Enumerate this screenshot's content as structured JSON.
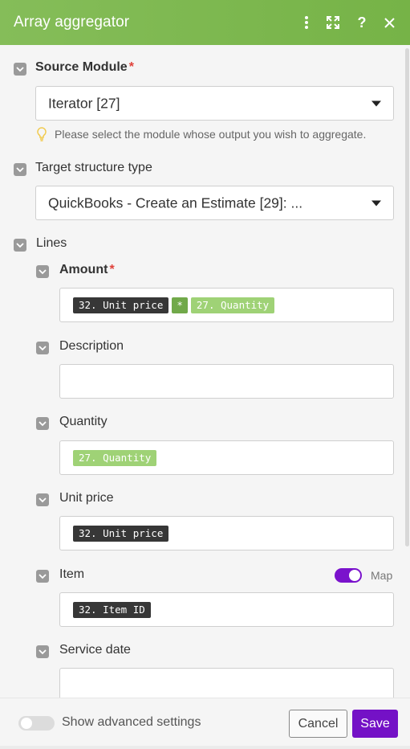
{
  "header": {
    "title": "Array aggregator"
  },
  "source_module": {
    "label": "Source Module",
    "required_mark": "*",
    "selected": "Iterator [27]",
    "hint": "Please select the module whose output you wish to aggregate."
  },
  "target_structure": {
    "label": "Target structure type",
    "selected": "QuickBooks - Create an Estimate [29]: ..."
  },
  "lines": {
    "label": "Lines",
    "amount": {
      "label": "Amount",
      "required_mark": "*",
      "pill_1": "32. Unit price",
      "operator": "*",
      "pill_2": "27. Quantity"
    },
    "description": {
      "label": "Description"
    },
    "quantity": {
      "label": "Quantity",
      "pill": "27. Quantity"
    },
    "unit_price": {
      "label": "Unit price",
      "pill": "32. Unit price"
    },
    "item": {
      "label": "Item",
      "map_label": "Map",
      "map_enabled": true,
      "pill": "32. Item ID"
    },
    "service_date": {
      "label": "Service date"
    }
  },
  "footer": {
    "advanced_label": "Show advanced settings",
    "cancel_label": "Cancel",
    "save_label": "Save"
  },
  "colors": {
    "header": "#7ab64b",
    "accent": "#7411c6",
    "pill_dark": "#373737",
    "pill_green": "#9fd276",
    "operator": "#71a94a",
    "required": "#e0413a"
  }
}
